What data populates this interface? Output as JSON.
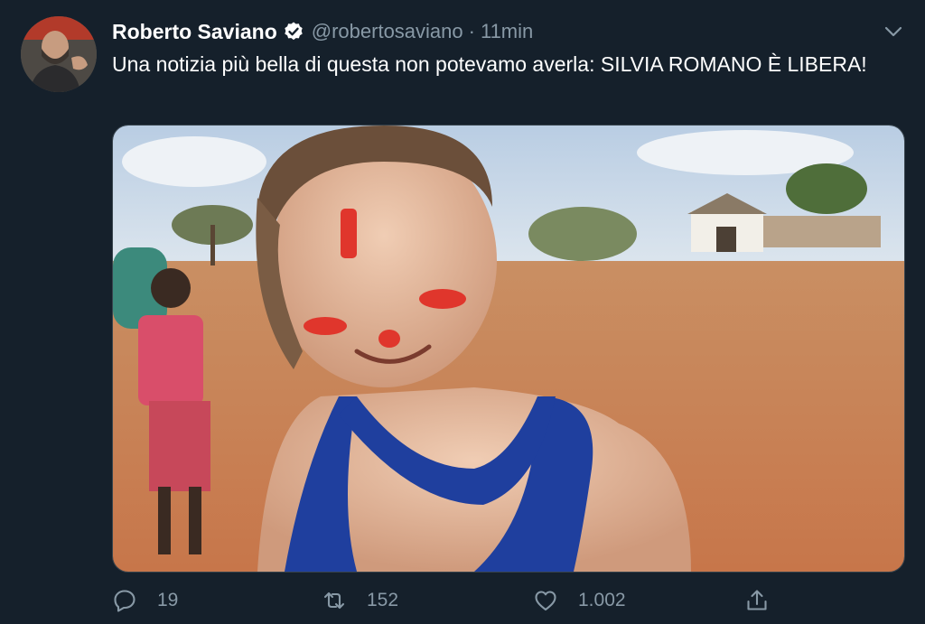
{
  "author": {
    "name": "Roberto Saviano",
    "handle": "@robertosaviano",
    "separator": "·",
    "time": "11min"
  },
  "tweet": {
    "text": "Una notizia più bella di questa non potevamo averla: SILVIA ROMANO È LIBERA!"
  },
  "actions": {
    "reply_count": "19",
    "retweet_count": "152",
    "like_count": "1.002"
  },
  "icons": {
    "verified": "verified-badge-icon",
    "menu": "chevron-down-icon",
    "reply": "reply-icon",
    "retweet": "retweet-icon",
    "like": "heart-icon",
    "share": "share-icon"
  },
  "colors": {
    "background": "#15202b",
    "secondary_text": "#8899a6",
    "border": "#38444d"
  }
}
